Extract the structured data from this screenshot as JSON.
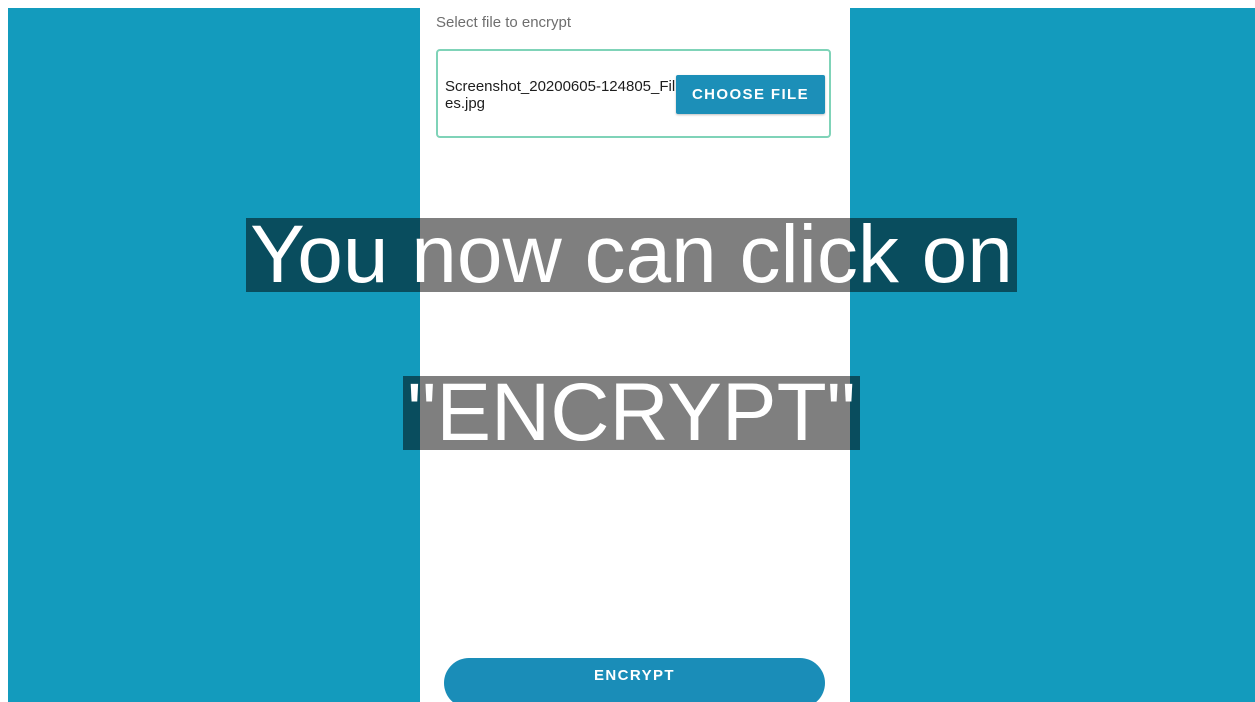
{
  "app": {
    "section_label": "Select file to encrypt",
    "selected_file": "Screenshot_20200605-124805_Files.jpg",
    "choose_file_label": "CHOOSE FILE",
    "encrypt_label": "ENCRYPT"
  },
  "overlay": {
    "line1": "You now can click on",
    "line2": "\"ENCRYPT\""
  },
  "colors": {
    "background": "#139bbd",
    "primary_button": "#1c8fb8",
    "file_box_border": "#7fd3b8"
  }
}
